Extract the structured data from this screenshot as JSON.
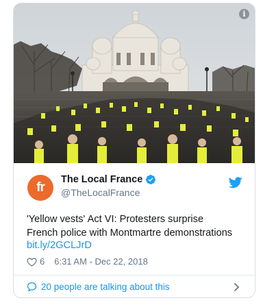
{
  "tweet": {
    "author_name": "The Local France",
    "author_handle": "@TheLocalFrance",
    "avatar_text": "fr",
    "text_lines": [
      "'Yellow vests' Act VI: Protesters surprise",
      "French police with Montmartre demonstrations"
    ],
    "link": "bit.ly/2GCLJrD",
    "like_count": "6",
    "timestamp": "6:31 AM - Dec 22, 2018",
    "conversation": "20 people are talking about this"
  },
  "icons": {
    "info": "info-icon",
    "verified": "verified-badge-icon",
    "brand": "twitter-bird-icon",
    "like": "heart-icon",
    "reply": "speech-bubble-icon",
    "more": "chevron-right-icon"
  },
  "colors": {
    "avatar_bg": "#ec6a2c",
    "link": "#1b95e0",
    "verified": "#1da1f2",
    "muted": "#657786"
  }
}
